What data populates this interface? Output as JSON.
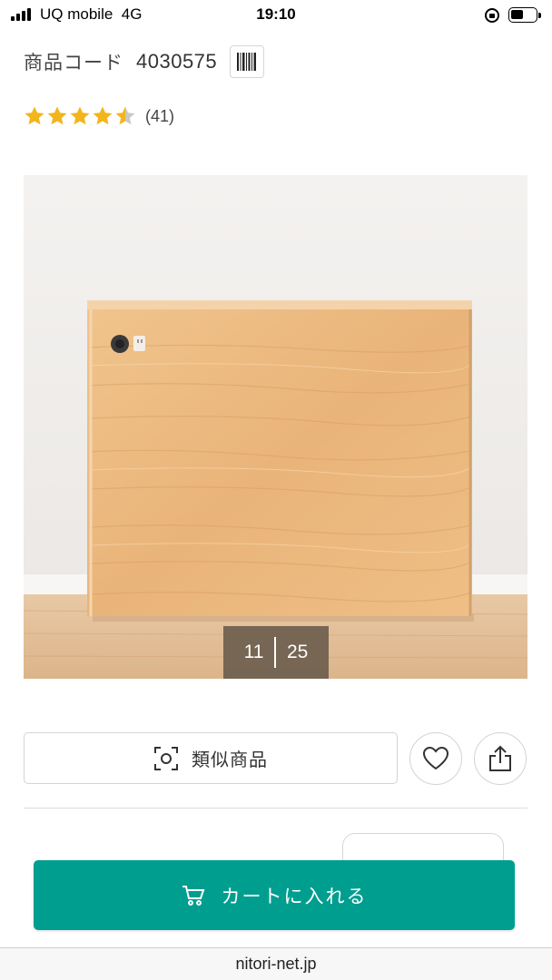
{
  "status_bar": {
    "carrier": "UQ mobile",
    "network": "4G",
    "time": "19:10"
  },
  "product": {
    "code_label": "商品コード",
    "code_value": "4030575",
    "rating": {
      "stars": 4.5,
      "max": 5,
      "review_count": "(41)"
    }
  },
  "gallery": {
    "current": "11",
    "total": "25"
  },
  "actions": {
    "similar_label": "類似商品",
    "favorite_icon": "heart-icon",
    "share_icon": "share-icon"
  },
  "cart": {
    "label": "カートに入れる",
    "color": "#009e8f"
  },
  "browser": {
    "url": "nitori-net.jp"
  }
}
